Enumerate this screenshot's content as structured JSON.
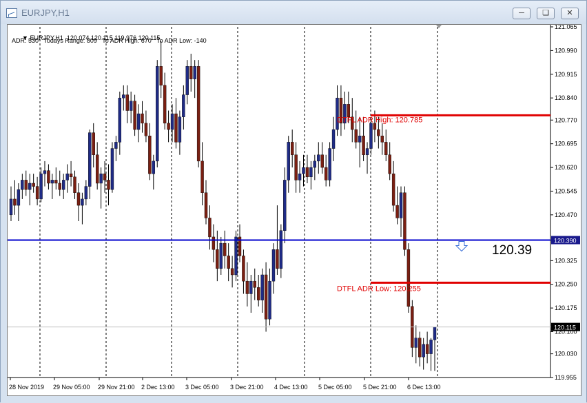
{
  "window": {
    "title": "EURJPY,H1",
    "buttons": [
      "minimize",
      "maximize",
      "close"
    ]
  },
  "indicator": {
    "header": "EURJPY,H1  120.074 120.115 119.976 120.115",
    "adr_line": "ADR: 530   Todays Range: 809   To ADR High: 670   To ADR Low: -140"
  },
  "labels": {
    "adr_high": "DTFL ADR High: 120.785",
    "adr_low": "DTFL ADR Low: 120.255",
    "current_big": "120.39"
  },
  "colors": {
    "bull_body": "#1f2b86",
    "bear_body": "#7a1f12",
    "wick": "#000000",
    "adr_line": "#e00000",
    "blue_line": "#0000cc",
    "price_tag_bg": "#1a1a8c",
    "current_tag_bg": "#000000"
  },
  "chart_data": {
    "type": "candlestick",
    "symbol": "EURJPY",
    "timeframe": "H1",
    "ylim": [
      119.955,
      121.065
    ],
    "y_ticks": [
      "121.065",
      "120.990",
      "120.915",
      "120.840",
      "120.770",
      "120.695",
      "120.620",
      "120.545",
      "120.470",
      "120.390",
      "120.325",
      "120.250",
      "120.175",
      "120.100",
      "120.030",
      "119.955"
    ],
    "x_ticks": [
      "28 Nov 2019",
      "29 Nov 05:00",
      "29 Nov 21:00",
      "2 Dec 13:00",
      "3 Dec 05:00",
      "3 Dec 21:00",
      "4 Dec 13:00",
      "5 Dec 05:00",
      "5 Dec 21:00",
      "6 Dec 13:00"
    ],
    "horizontal_lines": [
      {
        "label": "DTFL ADR High",
        "value": 120.785,
        "color": "#e00000"
      },
      {
        "label": "DTFL ADR Low",
        "value": 120.255,
        "color": "#e00000"
      },
      {
        "label": "level",
        "value": 120.39,
        "color": "#0000cc"
      }
    ],
    "price_tags": [
      "120.390",
      "120.115"
    ],
    "last_price": 120.115,
    "candles_ohlc": [
      [
        120.47,
        120.56,
        120.45,
        120.52
      ],
      [
        120.52,
        120.58,
        120.47,
        120.5
      ],
      [
        120.5,
        120.57,
        120.45,
        120.55
      ],
      [
        120.55,
        120.6,
        120.52,
        120.58
      ],
      [
        120.58,
        120.61,
        120.53,
        120.55
      ],
      [
        120.55,
        120.6,
        120.5,
        120.57
      ],
      [
        120.57,
        120.6,
        120.54,
        120.56
      ],
      [
        120.56,
        120.59,
        120.5,
        120.52
      ],
      [
        120.52,
        120.62,
        120.51,
        120.6
      ],
      [
        120.6,
        120.64,
        120.56,
        120.61
      ],
      [
        120.61,
        120.63,
        120.55,
        120.57
      ],
      [
        120.57,
        120.6,
        120.52,
        120.58
      ],
      [
        120.58,
        120.62,
        120.55,
        120.57
      ],
      [
        120.57,
        120.61,
        120.53,
        120.55
      ],
      [
        120.55,
        120.6,
        120.52,
        120.58
      ],
      [
        120.58,
        120.63,
        120.54,
        120.6
      ],
      [
        120.6,
        120.64,
        120.56,
        120.59
      ],
      [
        120.59,
        120.61,
        120.52,
        120.54
      ],
      [
        120.54,
        120.57,
        120.45,
        120.5
      ],
      [
        120.5,
        120.54,
        120.44,
        120.52
      ],
      [
        120.52,
        120.58,
        120.5,
        120.56
      ],
      [
        120.56,
        120.74,
        120.52,
        120.73
      ],
      [
        120.73,
        120.76,
        120.62,
        120.66
      ],
      [
        120.66,
        120.7,
        120.55,
        120.57
      ],
      [
        120.57,
        120.62,
        120.49,
        120.6
      ],
      [
        120.6,
        120.64,
        120.54,
        120.58
      ],
      [
        120.58,
        120.63,
        120.5,
        120.55
      ],
      [
        120.55,
        120.7,
        120.54,
        120.68
      ],
      [
        120.68,
        120.72,
        120.64,
        120.7
      ],
      [
        120.7,
        120.86,
        120.66,
        120.84
      ],
      [
        120.84,
        120.88,
        120.8,
        120.85
      ],
      [
        120.85,
        120.88,
        120.76,
        120.8
      ],
      [
        120.8,
        120.86,
        120.76,
        120.83
      ],
      [
        120.83,
        120.85,
        120.72,
        120.74
      ],
      [
        120.74,
        120.82,
        120.7,
        120.79
      ],
      [
        120.79,
        120.83,
        120.73,
        120.76
      ],
      [
        120.76,
        120.8,
        120.7,
        120.72
      ],
      [
        120.72,
        120.76,
        120.58,
        120.6
      ],
      [
        120.6,
        120.66,
        120.55,
        120.64
      ],
      [
        120.64,
        120.96,
        120.62,
        120.94
      ],
      [
        120.94,
        121.02,
        120.84,
        120.88
      ],
      [
        120.88,
        120.92,
        120.74,
        120.76
      ],
      [
        120.76,
        120.8,
        120.7,
        120.74
      ],
      [
        120.74,
        120.82,
        120.7,
        120.79
      ],
      [
        120.79,
        120.84,
        120.68,
        120.7
      ],
      [
        120.7,
        120.8,
        120.66,
        120.78
      ],
      [
        120.78,
        120.88,
        120.74,
        120.85
      ],
      [
        120.85,
        120.96,
        120.82,
        120.94
      ],
      [
        120.94,
        120.98,
        120.86,
        120.9
      ],
      [
        120.9,
        120.96,
        120.84,
        120.94
      ],
      [
        120.94,
        120.96,
        120.62,
        120.64
      ],
      [
        120.64,
        120.7,
        120.5,
        120.54
      ],
      [
        120.54,
        120.58,
        120.44,
        120.46
      ],
      [
        120.46,
        120.5,
        120.36,
        120.4
      ],
      [
        120.4,
        120.44,
        120.32,
        120.36
      ],
      [
        120.36,
        120.42,
        120.26,
        120.3
      ],
      [
        120.3,
        120.4,
        120.28,
        120.38
      ],
      [
        120.38,
        120.42,
        120.3,
        120.34
      ],
      [
        120.34,
        120.38,
        120.26,
        120.3
      ],
      [
        120.3,
        120.34,
        120.24,
        120.28
      ],
      [
        120.28,
        120.42,
        120.26,
        120.4
      ],
      [
        120.4,
        120.44,
        120.32,
        120.34
      ],
      [
        120.34,
        120.36,
        120.22,
        120.26
      ],
      [
        120.26,
        120.32,
        120.18,
        120.22
      ],
      [
        120.22,
        120.28,
        120.16,
        120.26
      ],
      [
        120.26,
        120.3,
        120.2,
        120.24
      ],
      [
        120.24,
        120.28,
        120.18,
        120.2
      ],
      [
        120.2,
        120.3,
        120.16,
        120.28
      ],
      [
        120.28,
        120.32,
        120.1,
        120.14
      ],
      [
        120.14,
        120.3,
        120.12,
        120.26
      ],
      [
        120.26,
        120.38,
        120.22,
        120.36
      ],
      [
        120.36,
        120.5,
        120.28,
        120.3
      ],
      [
        120.3,
        120.44,
        120.27,
        120.42
      ],
      [
        120.42,
        120.62,
        120.38,
        120.58
      ],
      [
        120.58,
        120.72,
        120.54,
        120.7
      ],
      [
        120.7,
        120.74,
        120.62,
        120.66
      ],
      [
        120.66,
        120.7,
        120.54,
        120.58
      ],
      [
        120.58,
        120.64,
        120.54,
        120.6
      ],
      [
        120.6,
        120.66,
        120.56,
        120.62
      ],
      [
        120.62,
        120.66,
        120.57,
        120.59
      ],
      [
        120.59,
        120.64,
        120.55,
        120.62
      ],
      [
        120.62,
        120.66,
        120.58,
        120.64
      ],
      [
        120.64,
        120.7,
        120.6,
        120.66
      ],
      [
        120.66,
        120.7,
        120.6,
        120.62
      ],
      [
        120.62,
        120.66,
        120.56,
        120.58
      ],
      [
        120.58,
        120.7,
        120.56,
        120.68
      ],
      [
        120.68,
        120.78,
        120.64,
        120.74
      ],
      [
        120.74,
        120.88,
        120.72,
        120.84
      ],
      [
        120.84,
        120.88,
        120.72,
        120.76
      ],
      [
        120.76,
        120.86,
        120.74,
        120.82
      ],
      [
        120.82,
        120.86,
        120.76,
        120.78
      ],
      [
        120.78,
        120.84,
        120.7,
        120.74
      ],
      [
        120.74,
        120.8,
        120.68,
        120.7
      ],
      [
        120.7,
        120.78,
        120.62,
        120.72
      ],
      [
        120.72,
        120.78,
        120.64,
        120.66
      ],
      [
        120.66,
        120.7,
        120.6,
        120.68
      ],
      [
        120.68,
        120.78,
        120.66,
        120.76
      ],
      [
        120.76,
        120.8,
        120.7,
        120.74
      ],
      [
        120.74,
        120.78,
        120.68,
        120.72
      ],
      [
        120.72,
        120.76,
        120.66,
        120.7
      ],
      [
        120.7,
        120.74,
        120.64,
        120.66
      ],
      [
        120.66,
        120.7,
        120.58,
        120.6
      ],
      [
        120.6,
        120.64,
        120.48,
        120.5
      ],
      [
        120.5,
        120.56,
        120.44,
        120.46
      ],
      [
        120.46,
        120.56,
        120.4,
        120.54
      ],
      [
        120.54,
        120.56,
        120.34,
        120.36
      ],
      [
        120.36,
        120.38,
        120.16,
        120.18
      ],
      [
        120.18,
        120.2,
        120.02,
        120.05
      ],
      [
        120.05,
        120.12,
        120.0,
        120.08
      ],
      [
        120.08,
        120.1,
        119.99,
        120.02
      ],
      [
        120.02,
        120.08,
        119.98,
        120.06
      ],
      [
        120.06,
        120.1,
        120.0,
        120.03
      ],
      [
        120.03,
        120.08,
        119.976,
        120.074
      ],
      [
        120.074,
        120.115,
        119.976,
        120.115
      ]
    ]
  }
}
